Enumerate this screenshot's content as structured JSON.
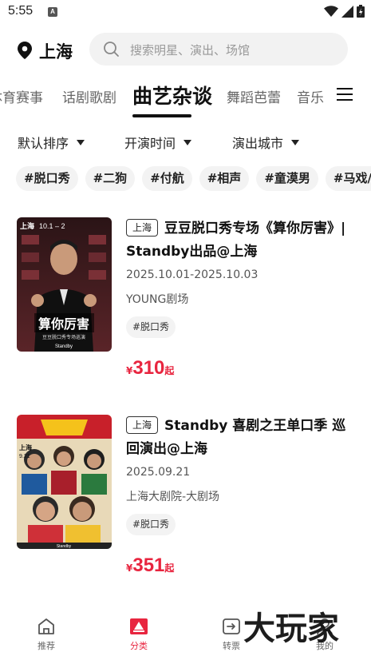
{
  "status_bar": {
    "time": "5:55",
    "notif_icon": "A"
  },
  "header": {
    "city": "上海",
    "search_placeholder": "搜索明星、演出、场馆"
  },
  "tabs": [
    {
      "label": "体育赛事"
    },
    {
      "label": "话剧歌剧"
    },
    {
      "label": "曲艺杂谈"
    },
    {
      "label": "舞蹈芭蕾"
    },
    {
      "label": "音乐"
    }
  ],
  "filters": [
    {
      "label": "默认排序"
    },
    {
      "label": "开演时间"
    },
    {
      "label": "演出城市"
    }
  ],
  "hashtags": [
    "#脱口秀",
    "#二狗",
    "#付航",
    "#相声",
    "#童漠男",
    "#马戏/杂技"
  ],
  "events": [
    {
      "city": "上海",
      "title": "豆豆脱口秀专场《算你厉害》| Standby出品@上海",
      "date": "2025.10.01-2025.10.03",
      "venue": "YOUNG剧场",
      "genre": "#脱口秀",
      "currency": "¥",
      "price": "310",
      "price_suffix": "起",
      "poster": {
        "city": "上海",
        "dates": "10.1 – 2",
        "headline": "算你厉害",
        "sub": "豆豆脱口秀专场巡演",
        "brand": "Standby"
      }
    },
    {
      "city": "上海",
      "title": "Standby 喜剧之王单口季 巡回演出@上海",
      "date": "2025.09.21",
      "venue": "上海大剧院-大剧场",
      "genre": "#脱口秀",
      "currency": "¥",
      "price": "351",
      "price_suffix": "起",
      "poster": {
        "city": "上海",
        "dates": "9.21",
        "brand": "Standby"
      }
    }
  ],
  "bottom_nav": [
    {
      "label": "推荐",
      "icon": "home-icon"
    },
    {
      "label": "分类",
      "icon": "category-icon",
      "active": true
    },
    {
      "label": "转票",
      "icon": "transfer-ticket-icon"
    },
    {
      "label": "我的",
      "icon": "profile-icon"
    }
  ],
  "watermark": "大玩家",
  "colors": {
    "accent": "#e8253f",
    "text": "#222222",
    "chip_bg": "#f3f3f3"
  }
}
